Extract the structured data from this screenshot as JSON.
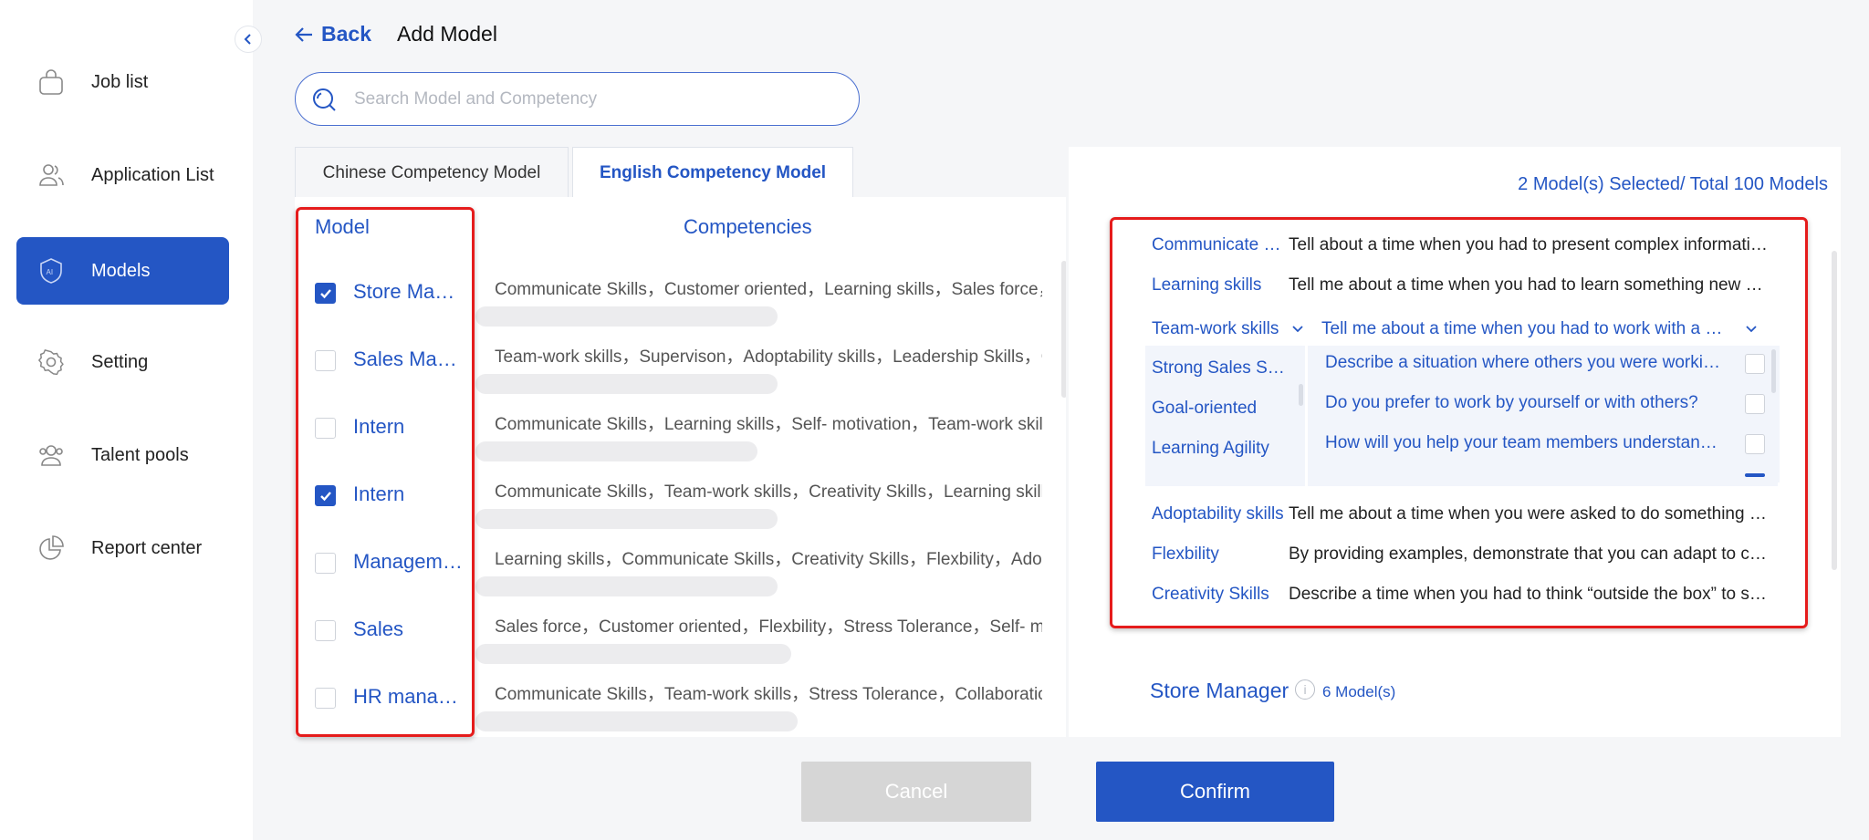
{
  "sidebar": {
    "items": [
      {
        "label": "Job list",
        "icon": "bag-icon",
        "active": false
      },
      {
        "label": "Application List",
        "icon": "users-icon",
        "active": false
      },
      {
        "label": "Models",
        "icon": "ai-shield-icon",
        "active": true
      },
      {
        "label": "Setting",
        "icon": "gear-icon",
        "active": false
      },
      {
        "label": "Talent pools",
        "icon": "group-icon",
        "active": false
      },
      {
        "label": "Report center",
        "icon": "pie-chart-icon",
        "active": false
      }
    ]
  },
  "header": {
    "back_label": "Back",
    "title": "Add Model"
  },
  "search": {
    "placeholder": "Search Model and Competency",
    "value": ""
  },
  "tabs": [
    {
      "label": "Chinese Competency Model",
      "active": false
    },
    {
      "label": "English Competency Model",
      "active": true
    }
  ],
  "left": {
    "model_header": "Model",
    "competencies_header": "Competencies",
    "rows": [
      {
        "name": "Store Manager",
        "checked": true,
        "competencies": "Communicate Skills，Customer oriented，Learning skills，Sales force，Stress Tolerance"
      },
      {
        "name": "Sales Manager",
        "checked": false,
        "competencies": "Team-work skills，Supervison，Adoptability skills，Leadership Skills，Creativity"
      },
      {
        "name": "Intern",
        "checked": false,
        "competencies": "Communicate Skills，Learning skills，Self- motivation，Team-work skills"
      },
      {
        "name": "Intern",
        "checked": true,
        "competencies": "Communicate Skills，Team-work skills，Creativity Skills，Learning skills"
      },
      {
        "name": "Management",
        "checked": false,
        "competencies": "Learning skills，Communicate Skills，Creativity Skills，Flexbility，Adoptability"
      },
      {
        "name": "Sales",
        "checked": false,
        "competencies": "Sales force，Customer oriented，Flexbility，Stress Tolerance，Self- motivation"
      },
      {
        "name": "HR manager",
        "checked": false,
        "competencies": "Communicate Skills，Team-work skills，Stress Tolerance，Collaboration"
      }
    ]
  },
  "right": {
    "summary": "2 Model(s) Selected/ Total 100 Models",
    "rows_top": [
      {
        "competency": "Communicate Skills",
        "question": "Tell about a time when you had to present complex information to others."
      },
      {
        "competency": "Learning skills",
        "question": "Tell me about a time when you had to learn something new quickly."
      }
    ],
    "dropdown": {
      "selected_competency": "Team-work skills",
      "selected_question": "Tell me about a time when you had to work with a difficult coworker.",
      "competency_options": [
        "Strong Sales Skills",
        "Goal-oriented",
        "Learning Agility"
      ],
      "question_options": [
        {
          "text": "Describe a situation where others you were working with disagreed with your ideas.",
          "checked": false
        },
        {
          "text": "Do you prefer to work by yourself or with others?",
          "checked": false
        },
        {
          "text": "How will you help your team members understand a new process?",
          "checked": false
        }
      ]
    },
    "rows_bottom": [
      {
        "competency": "Adoptability skills",
        "question": "Tell me about a time when you were asked to do something you had never done before."
      },
      {
        "competency": "Flexbility",
        "question": "By providing examples, demonstrate that you can adapt to changing circumstances."
      },
      {
        "competency": "Creativity Skills",
        "question": "Describe a time when you had to think “outside the box” to solve a problem."
      }
    ],
    "group": {
      "title": "Store Manager",
      "count": "6 Model(s)"
    }
  },
  "footer": {
    "cancel_label": "Cancel",
    "confirm_label": "Confirm"
  },
  "colors": {
    "accent": "#2456c4",
    "highlight": "#e51c1c",
    "disabled": "#d6d6d6"
  }
}
